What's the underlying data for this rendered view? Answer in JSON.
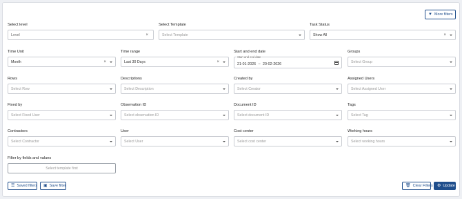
{
  "header": {
    "more_filters_label": "More filters"
  },
  "fields": {
    "level": {
      "label": "Select level",
      "value": "Level"
    },
    "template": {
      "label": "Select Template",
      "placeholder": "Select Template"
    },
    "task_status": {
      "label": "Task Status",
      "value": "Show All"
    },
    "time_unit": {
      "label": "Time Unit",
      "value": "Month"
    },
    "time_range": {
      "label": "Time range",
      "value": "Last 30 Days"
    },
    "dates": {
      "label": "Start and end date",
      "legend": "Start and end date",
      "start": "21-01-2026",
      "separator": "–",
      "end": "20-02-2026"
    },
    "groups": {
      "label": "Groups",
      "placeholder": "Select Group"
    },
    "rows": {
      "label": "Rows",
      "placeholder": "Select Row"
    },
    "descriptions": {
      "label": "Descriptions",
      "placeholder": "Select Description"
    },
    "created_by": {
      "label": "Created by",
      "placeholder": "Select Creator"
    },
    "assigned_users": {
      "label": "Assigned Users",
      "placeholder": "Select Assigned User"
    },
    "fixed_by": {
      "label": "Fixed by",
      "placeholder": "Select Fixed User"
    },
    "observation_id": {
      "label": "Observation ID",
      "placeholder": "Select observation ID"
    },
    "document_id": {
      "label": "Document ID",
      "placeholder": "Select document ID"
    },
    "tags": {
      "label": "Tags",
      "placeholder": "Select Tag"
    },
    "contractors": {
      "label": "Contractors",
      "placeholder": "Select Contractor"
    },
    "user": {
      "label": "User",
      "placeholder": "Select User"
    },
    "cost_center": {
      "label": "Cost center",
      "placeholder": "Select cost center"
    },
    "working_hours": {
      "label": "Working hours",
      "placeholder": "Select working hours"
    }
  },
  "filter_by_fields": {
    "label": "Filter by fields and values",
    "placeholder": "Select template first"
  },
  "footer": {
    "saved_filters_label": "Saved filters",
    "save_filter_label": "Save filter",
    "clear_filters_label": "Clear Filters",
    "update_label": "Update"
  }
}
